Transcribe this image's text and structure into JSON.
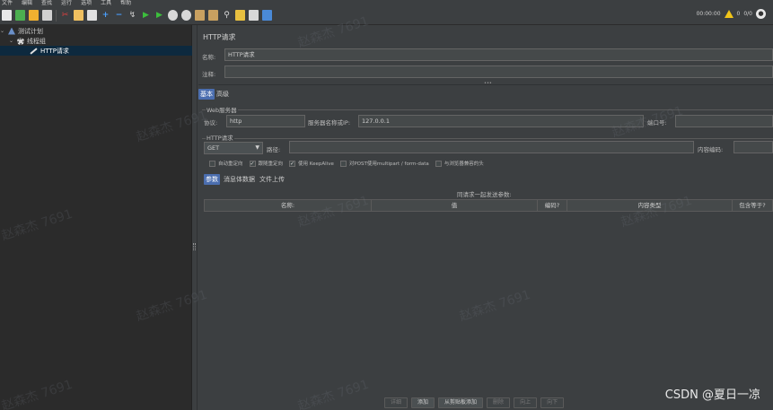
{
  "menu": [
    "文件",
    "编辑",
    "查找",
    "运行",
    "选项",
    "工具",
    "帮助"
  ],
  "toolbar": {
    "timer": "00:00:00",
    "warn_count": "0",
    "threads": "0/0"
  },
  "tree": {
    "root": "测试计划",
    "thread_group": "线程组",
    "sampler": "HTTP请求"
  },
  "panel": {
    "title": "HTTP请求",
    "name_label": "名称:",
    "name_value": "HTTP请求",
    "comment_label": "注释:",
    "comment_value": "",
    "tabs": [
      "基本",
      "高级"
    ],
    "web_server_legend": "Web服务器",
    "protocol_label": "协议:",
    "protocol_value": "http",
    "server_label": "服务器名称或IP:",
    "server_value": "127.0.0.1",
    "port_label": "端口号:",
    "port_value": "",
    "http_legend": "HTTP请求",
    "method_value": "GET",
    "path_label": "路径:",
    "path_value": "",
    "encoding_label": "内容编码:",
    "encoding_value": "",
    "checkboxes": [
      {
        "label": "自动重定向",
        "checked": false
      },
      {
        "label": "跟随重定向",
        "checked": true
      },
      {
        "label": "使用 KeepAlive",
        "checked": true
      },
      {
        "label": "对POST使用multipart / form-data",
        "checked": false
      },
      {
        "label": "与浏览器兼容的头",
        "checked": false
      }
    ],
    "subtabs": [
      "参数",
      "消息体数据",
      "文件上传"
    ],
    "params_caption": "同请求一起发送参数:",
    "columns": [
      "名称:",
      "值",
      "编码?",
      "内容类型",
      "包含等于?"
    ],
    "buttons": [
      {
        "label": "详细",
        "disabled": true
      },
      {
        "label": "添加",
        "disabled": false
      },
      {
        "label": "从剪贴板添加",
        "disabled": false
      },
      {
        "label": "删除",
        "disabled": true
      },
      {
        "label": "向上",
        "disabled": true
      },
      {
        "label": "向下",
        "disabled": true
      }
    ]
  },
  "watermark": "赵森杰 7691",
  "footer_credit": "CSDN @夏日一凉"
}
